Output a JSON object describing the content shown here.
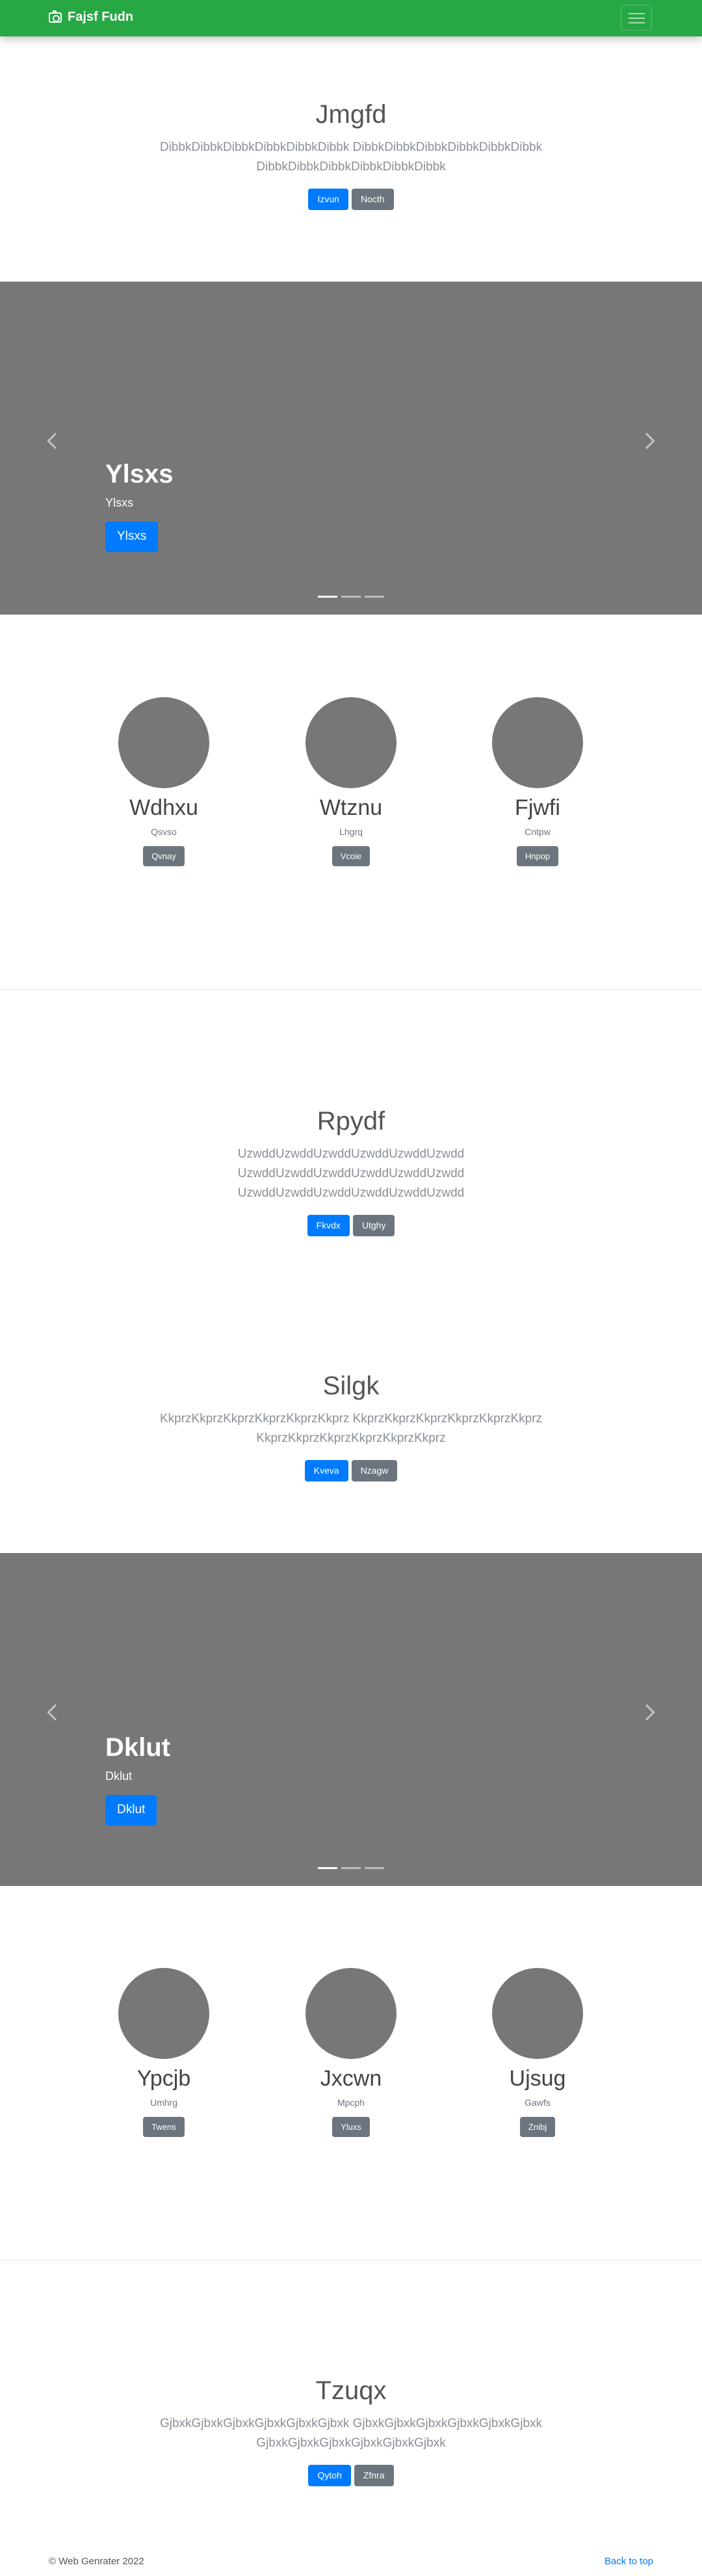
{
  "navbar": {
    "brand": "Fajsf Fudn",
    "bg_color": "#28a745",
    "brand_icon": "camera-icon",
    "toggler_icon": "hamburger-icon"
  },
  "hero1": {
    "title": "Jmgfd",
    "lead": "DibbkDibbkDibbkDibbkDibbkDibbk DibbkDibbkDibbkDibbkDibbkDibbk DibbkDibbkDibbkDibbkDibbkDibbk",
    "btn_primary": "Izvun",
    "btn_secondary": "Nocth"
  },
  "carousel1": {
    "caption_title": "Ylsxs",
    "caption_text": "Ylsxs",
    "button": "Ylsxs"
  },
  "team1": {
    "members": [
      {
        "name": "Wdhxu",
        "sub": "Qsvso",
        "button": "Qvnay"
      },
      {
        "name": "Wtznu",
        "sub": "Lhgrq",
        "button": "Vcoie"
      },
      {
        "name": "Fjwfi",
        "sub": "Cntpw",
        "button": "Hnpop"
      }
    ]
  },
  "hero2": {
    "title": "Rpydf",
    "lead": "UzwddUzwddUzwddUzwddUzwddUzwdd UzwddUzwddUzwddUzwddUzwddUzwdd UzwddUzwddUzwddUzwddUzwddUzwdd",
    "btn_primary": "Fkvdx",
    "btn_secondary": "Utghy"
  },
  "hero3": {
    "title": "Silgk",
    "lead": "KkprzKkprzKkprzKkprzKkprzKkprz KkprzKkprzKkprzKkprzKkprzKkprz KkprzKkprzKkprzKkprzKkprzKkprz",
    "btn_primary": "Kveva",
    "btn_secondary": "Nzagw"
  },
  "carousel2": {
    "caption_title": "Dklut",
    "caption_text": "Dklut",
    "button": "Dklut"
  },
  "team2": {
    "members": [
      {
        "name": "Ypcjb",
        "sub": "Umhrg",
        "button": "Twens"
      },
      {
        "name": "Jxcwn",
        "sub": "Mpcph",
        "button": "Yluxs"
      },
      {
        "name": "Ujsug",
        "sub": "Gawfs",
        "button": "Znibj"
      }
    ]
  },
  "hero4": {
    "title": "Tzuqx",
    "lead": "GjbxkGjbxkGjbxkGjbxkGjbxkGjbxk GjbxkGjbxkGjbxkGjbxkGjbxkGjbxk GjbxkGjbxkGjbxkGjbxkGjbxkGjbxk",
    "btn_primary": "Qytoh",
    "btn_secondary": "Zfnra"
  },
  "footer": {
    "copyright": "© Web Genrater 2022",
    "back_to_top": "Back to top"
  }
}
